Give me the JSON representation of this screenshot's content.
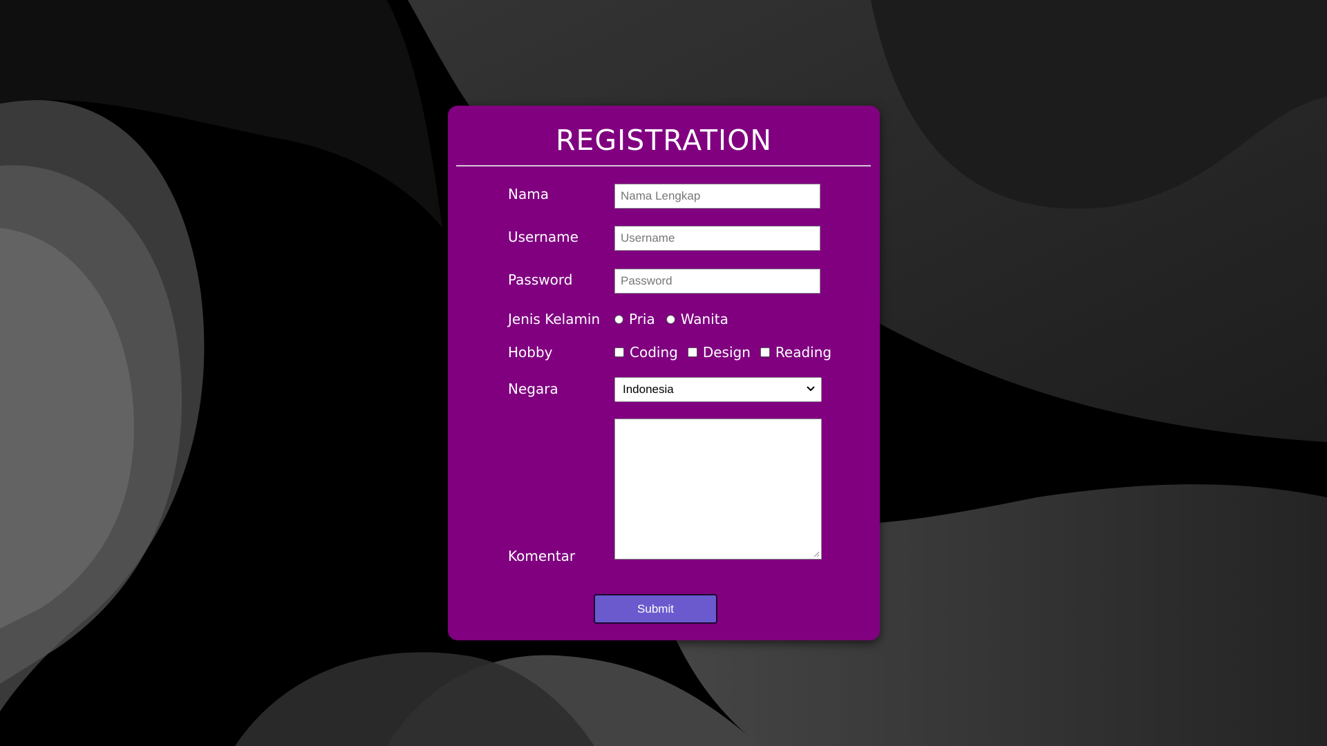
{
  "page": {
    "background_color": "#000000",
    "card_color": "#800080",
    "button_color": "#6a5acd"
  },
  "form": {
    "title": "REGISTRATION",
    "nama": {
      "label": "Nama",
      "placeholder": "Nama Lengkap",
      "value": ""
    },
    "username": {
      "label": "Username",
      "placeholder": "Username",
      "value": ""
    },
    "password": {
      "label": "Password",
      "placeholder": "Password",
      "value": ""
    },
    "gender": {
      "label": "Jenis Kelamin",
      "options": [
        "Pria",
        "Wanita"
      ],
      "selected": null
    },
    "hobby": {
      "label": "Hobby",
      "options": [
        "Coding",
        "Design",
        "Reading"
      ],
      "checked": []
    },
    "negara": {
      "label": "Negara",
      "selected": "Indonesia"
    },
    "komentar": {
      "label": "Komentar",
      "value": ""
    },
    "submit_label": "Submit"
  }
}
